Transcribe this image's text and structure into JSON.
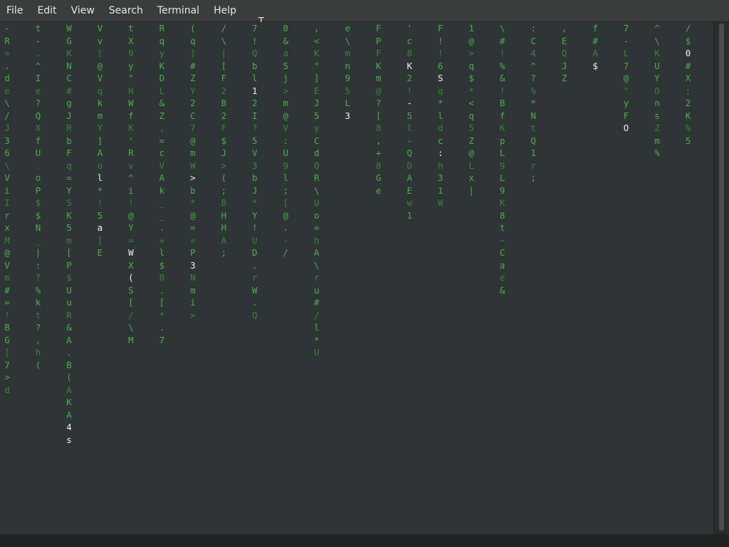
{
  "menubar": {
    "items": [
      "File",
      "Edit",
      "View",
      "Search",
      "Terminal",
      "Help"
    ]
  },
  "terminal": {
    "rain_color": "#3fb83f",
    "head_color": "#f0f0f0",
    "columns": [
      {
        "chars": "-R=.de\\/J36\\ViIrxM@Vm#=!BG[7>d",
        "w": []
      },
      {
        "chars": "t-.^Ie?QXfU.oP$$N_|:?%kt?,h(",
        "w": []
      },
      {
        "chars": "WGKNC#gJRbFq=YSK5m[P$UuR&A,B(AKA4s",
        "w": [
          32,
          33
        ]
      },
      {
        "chars": "Vv[@VqkmY]Aol*!5a]E",
        "w": [
          12,
          16
        ]
      },
      {
        "chars": "tX9y\"HWfK'Rv^i!@Y=WX(S[/\\M",
        "w": [
          18,
          20
        ]
      },
      {
        "chars": "RqyKDL&Z,=cVAk__.+l$0.[*.7",
        "w": []
      },
      {
        "chars": "(q]#ZY2C7@mW>b*@==P3Nmi>",
        "w": [
          12,
          19
        ]
      },
      {
        "chars": "/\\|[F2B2F$J>(;BHHA;",
        "w": []
      },
      {
        "chars": "7!Qbl12I?5V3bJ*Y!UD.rW.Q",
        "w": [
          5
        ]
      },
      {
        "chars": "0&a5j>m@V:U9l;[@.-/",
        "w": []
      },
      {
        "chars": ",<K\"]EJ5yCdQR\\Uo=hA\\ru#/l*U",
        "w": []
      },
      {
        "chars": "e\\mn95L3",
        "w": [
          7
        ]
      },
      {
        "chars": "FPFKm@?[8,+8Ge",
        "w": []
      },
      {
        "chars": "'c8K2!-5l-QDAEw1",
        "w": [
          3,
          6
        ]
      },
      {
        "chars": "F!!6Sq*ldc:h31W",
        "w": [
          4,
          10
        ]
      },
      {
        "chars": "1@>q$*<q5Z@Lx|",
        "w": []
      },
      {
        "chars": "\\#!%&!BfKpL9L9K8t~Cae&",
        "w": []
      },
      {
        "chars": ":C4^?%*NtQ1r;",
        "w": []
      },
      {
        "chars": ",EQJZ",
        "w": []
      },
      {
        "chars": "f#A$",
        "w": [
          3
        ]
      },
      {
        "chars": "7-L7@\"yFO",
        "w": [
          8
        ]
      },
      {
        "chars": "^\\KUYOnsZm%",
        "w": []
      },
      {
        "chars": "/$0#X;2K%5",
        "w": [
          2
        ]
      }
    ]
  }
}
